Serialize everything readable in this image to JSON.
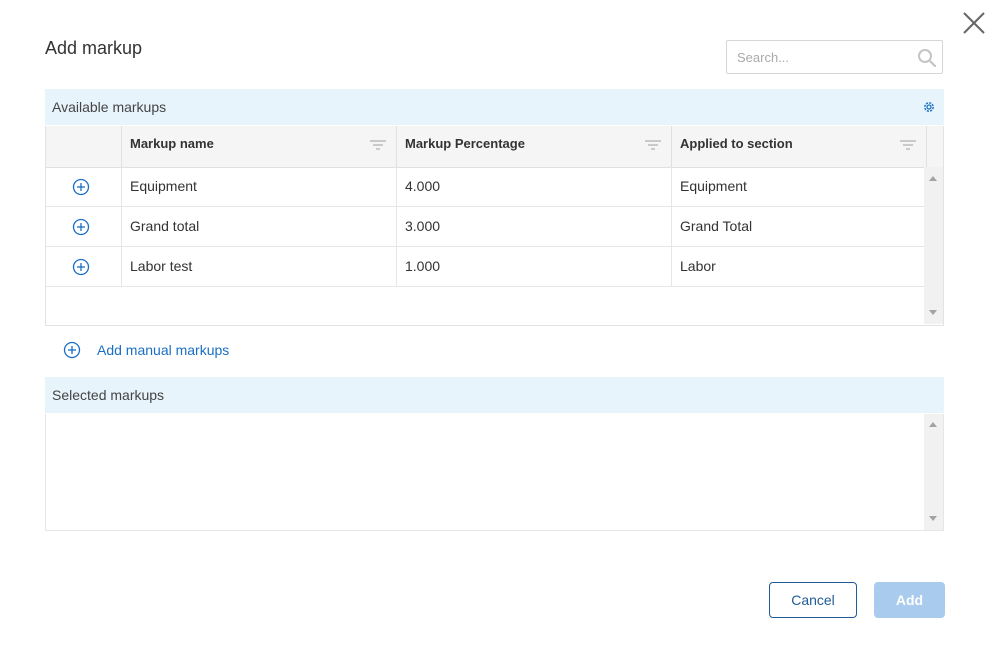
{
  "dialog": {
    "title": "Add markup"
  },
  "search": {
    "placeholder": "Search..."
  },
  "available": {
    "title": "Available markups",
    "columns": [
      "Markup name",
      "Markup Percentage",
      "Applied to section"
    ],
    "rows": [
      {
        "name": "Equipment",
        "percentage": "4.000",
        "section": "Equipment"
      },
      {
        "name": "Grand total",
        "percentage": "3.000",
        "section": "Grand Total"
      },
      {
        "name": "Labor test",
        "percentage": "1.000",
        "section": "Labor"
      }
    ]
  },
  "manual": {
    "label": "Add manual markups"
  },
  "selected": {
    "title": "Selected markups"
  },
  "buttons": {
    "cancel": "Cancel",
    "add": "Add"
  },
  "colors": {
    "accent": "#1a6fc4",
    "section_bg": "#e8f4fb",
    "add_disabled": "#a8cbee"
  }
}
